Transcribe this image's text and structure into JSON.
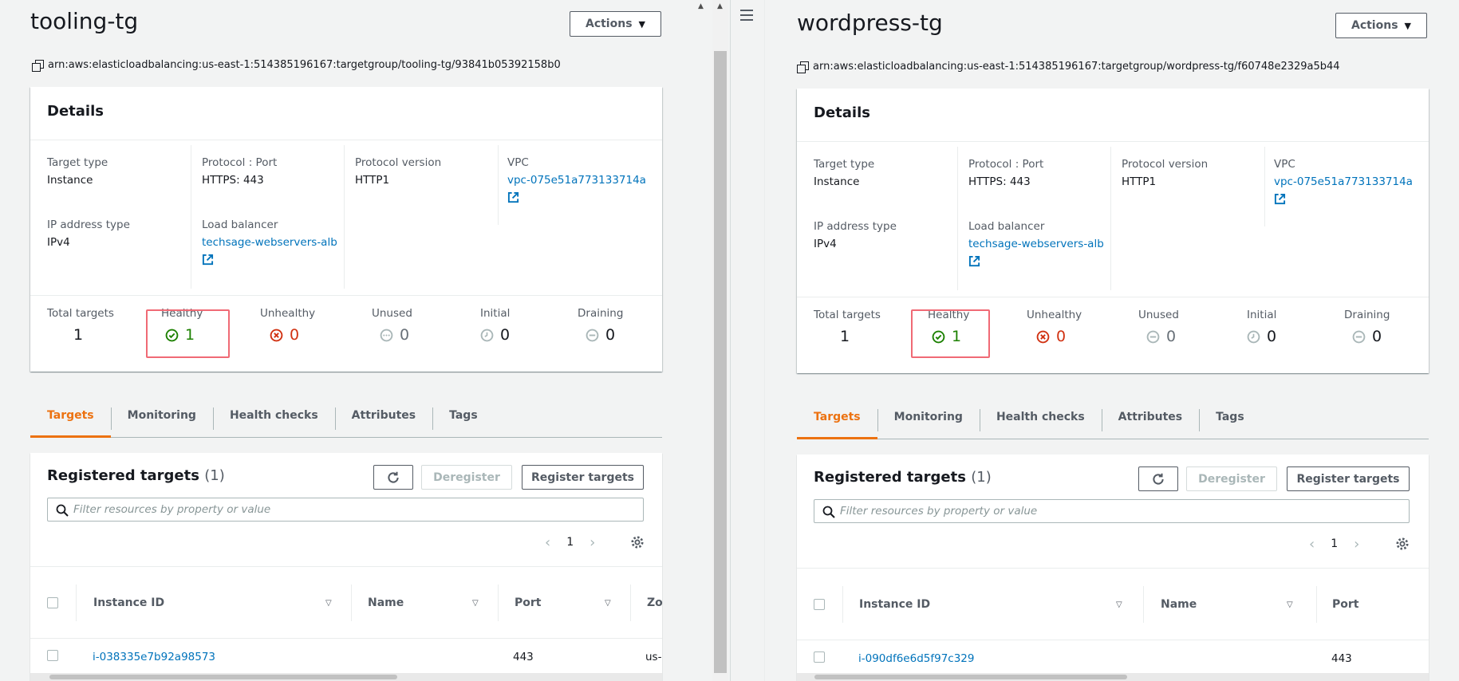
{
  "colors": {
    "accent": "#ec7211",
    "link": "#0073bb",
    "healthy": "#1d8102",
    "unhealthy": "#d13212",
    "highlight": "#f06a75"
  },
  "panes": [
    {
      "title": "tooling-tg",
      "actions_label": "Actions",
      "arn": "arn:aws:elasticloadbalancing:us-east-1:514385196167:targetgroup/tooling-tg/93841b05392158b0",
      "details": {
        "header": "Details",
        "target_type_label": "Target type",
        "target_type": "Instance",
        "protocol_port_label": "Protocol : Port",
        "protocol_port": "HTTPS: 443",
        "protocol_version_label": "Protocol version",
        "protocol_version": "HTTP1",
        "vpc_label": "VPC",
        "vpc": "vpc-075e51a773133714a",
        "ip_type_label": "IP address type",
        "ip_type": "IPv4",
        "lb_label": "Load balancer",
        "lb": "techsage-webservers-alb"
      },
      "stats": {
        "total_label": "Total targets",
        "total": "1",
        "healthy_label": "Healthy",
        "healthy": "1",
        "unhealthy_label": "Unhealthy",
        "unhealthy": "0",
        "unused_label": "Unused",
        "unused": "0",
        "initial_label": "Initial",
        "initial": "0",
        "draining_label": "Draining",
        "draining": "0"
      },
      "tabs": [
        "Targets",
        "Monitoring",
        "Health checks",
        "Attributes",
        "Tags"
      ],
      "registered": {
        "title": "Registered targets",
        "count": "(1)",
        "deregister_label": "Deregister",
        "register_label": "Register targets",
        "search_placeholder": "Filter resources by property or value",
        "page": "1",
        "columns": [
          "Instance ID",
          "Name",
          "Port",
          "Zo"
        ],
        "row": {
          "instance_id": "i-038335e7b92a98573",
          "name": "",
          "port": "443",
          "zone": "us-"
        }
      }
    },
    {
      "title": "wordpress-tg",
      "actions_label": "Actions",
      "arn": "arn:aws:elasticloadbalancing:us-east-1:514385196167:targetgroup/wordpress-tg/f60748e2329a5b44",
      "details": {
        "header": "Details",
        "target_type_label": "Target type",
        "target_type": "Instance",
        "protocol_port_label": "Protocol : Port",
        "protocol_port": "HTTPS: 443",
        "protocol_version_label": "Protocol version",
        "protocol_version": "HTTP1",
        "vpc_label": "VPC",
        "vpc": "vpc-075e51a773133714a",
        "ip_type_label": "IP address type",
        "ip_type": "IPv4",
        "lb_label": "Load balancer",
        "lb": "techsage-webservers-alb"
      },
      "stats": {
        "total_label": "Total targets",
        "total": "1",
        "healthy_label": "Healthy",
        "healthy": "1",
        "unhealthy_label": "Unhealthy",
        "unhealthy": "0",
        "unused_label": "Unused",
        "unused": "0",
        "initial_label": "Initial",
        "initial": "0",
        "draining_label": "Draining",
        "draining": "0"
      },
      "tabs": [
        "Targets",
        "Monitoring",
        "Health checks",
        "Attributes",
        "Tags"
      ],
      "registered": {
        "title": "Registered targets",
        "count": "(1)",
        "deregister_label": "Deregister",
        "register_label": "Register targets",
        "search_placeholder": "Filter resources by property or value",
        "page": "1",
        "columns": [
          "Instance ID",
          "Name",
          "Port"
        ],
        "row": {
          "instance_id": "i-090df6e6d5f97c329",
          "name": "",
          "port": "443"
        }
      }
    }
  ]
}
